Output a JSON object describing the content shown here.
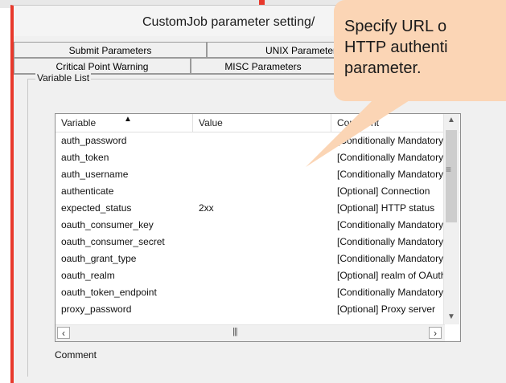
{
  "window": {
    "title": "CustomJob parameter setting/"
  },
  "tabs": {
    "row1": [
      {
        "label": "Submit Parameters"
      },
      {
        "label": "UNIX Parameters"
      }
    ],
    "row2": [
      {
        "label": "Critical Point Warning"
      },
      {
        "label": "MISC Parameters"
      }
    ]
  },
  "variable_list": {
    "group_label": "Variable List",
    "columns": {
      "variable": "Variable",
      "value": "Value",
      "comment": "Comment"
    },
    "rows": [
      {
        "variable": "auth_password",
        "value": "",
        "comment": "[Conditionally Mandatory"
      },
      {
        "variable": "auth_token",
        "value": "",
        "comment": "[Conditionally Mandatory"
      },
      {
        "variable": "auth_username",
        "value": "",
        "comment": "[Conditionally Mandatory"
      },
      {
        "variable": "authenticate",
        "value": "",
        "comment": "[Optional] Connection"
      },
      {
        "variable": "expected_status",
        "value": "2xx",
        "comment": "[Optional] HTTP status"
      },
      {
        "variable": "oauth_consumer_key",
        "value": "",
        "comment": "[Conditionally Mandatory"
      },
      {
        "variable": "oauth_consumer_secret",
        "value": "",
        "comment": "[Conditionally Mandatory"
      },
      {
        "variable": "oauth_grant_type",
        "value": "",
        "comment": "[Conditionally Mandatory"
      },
      {
        "variable": "oauth_realm",
        "value": "",
        "comment": "[Optional] realm of OAuth"
      },
      {
        "variable": "oauth_token_endpoint",
        "value": "",
        "comment": "[Conditionally Mandatory"
      },
      {
        "variable": "proxy_password",
        "value": "",
        "comment": "[Optional] Proxy server"
      }
    ]
  },
  "comment_label": "Comment",
  "callout": {
    "text": "Specify URL o\nHTTP authenti\nparameter."
  },
  "icons": {
    "sort": "sort-ascending-icon",
    "scroll_up": "scroll-up-icon",
    "scroll_down": "scroll-down-icon",
    "scroll_left": "scroll-left-icon",
    "scroll_right": "scroll-right-icon"
  },
  "colors": {
    "accent": "#e8392c",
    "callout": "#fbd5b5",
    "window_bg": "#f0f0f0"
  }
}
